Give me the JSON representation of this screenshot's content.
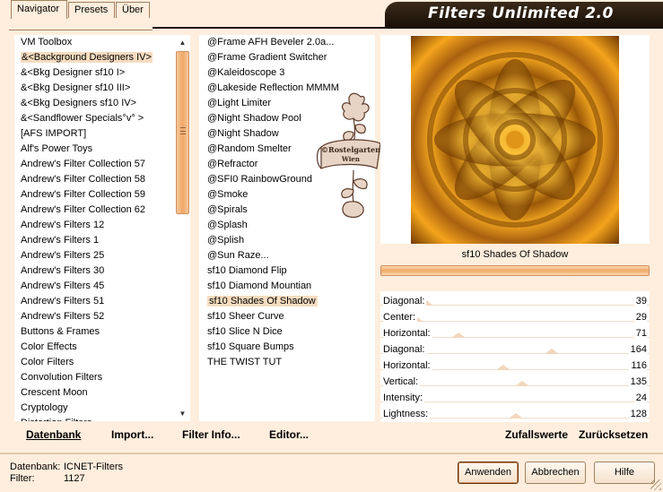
{
  "app": {
    "title": "Filters Unlimited 2.0"
  },
  "tabs": [
    {
      "label": "Navigator",
      "active": true
    },
    {
      "label": "Presets",
      "active": false
    },
    {
      "label": "Über",
      "active": false
    }
  ],
  "categories": {
    "selected_index": 1,
    "items": [
      "VM Toolbox",
      "&<Background Designers IV>",
      "&<Bkg Designer sf10 I>",
      "&<Bkg Designer sf10 III>",
      "&<Bkg Designers sf10 IV>",
      "&<Sandflower Specials°v° >",
      "[AFS IMPORT]",
      "Alf's Power Toys",
      "Andrew's Filter Collection 57",
      "Andrew's Filter Collection 58",
      "Andrew's Filter Collection 59",
      "Andrew's Filter Collection 62",
      "Andrew's Filters 12",
      "Andrew's Filters 1",
      "Andrew's Filters 25",
      "Andrew's Filters 30",
      "Andrew's Filters 45",
      "Andrew's Filters 51",
      "Andrew's Filters 52",
      "Buttons & Frames",
      "Color Effects",
      "Color Filters",
      "Convolution Filters",
      "Crescent Moon",
      "Cryptology",
      "Distortion Filters"
    ]
  },
  "filters": {
    "selected_index": 17,
    "items": [
      "@Frame AFH Beveler 2.0a...",
      "@Frame Gradient Switcher",
      "@Kaleidoscope 3",
      "@Lakeside Reflection MMMM",
      "@Light Limiter",
      "@Night Shadow Pool",
      "@Night Shadow",
      "@Random Smelter",
      "@Refractor",
      "@SFI0 RainbowGround",
      "@Smoke",
      "@Spirals",
      "@Splash",
      "@Splish",
      "@Sun Raze...",
      "sf10 Diamond Flip",
      "sf10 Diamond Mountian",
      "sf10 Shades Of Shadow",
      "sf10 Sheer Curve",
      "sf10 Slice N Dice",
      "sf10 Square Bumps",
      "THE TWIST TUT"
    ]
  },
  "watermark": {
    "line1": "©Rostelgarten",
    "line2": "Wien"
  },
  "preview": {
    "filter_name": "sf10 Shades Of Shadow"
  },
  "params": [
    {
      "label": "Diagonal:",
      "value": "39",
      "level": 39
    },
    {
      "label": "Center:",
      "value": "29",
      "level": 29
    },
    {
      "label": "Horizontal:",
      "value": "71",
      "level": 71
    },
    {
      "label": "Diagonal:",
      "value": "164",
      "level": 164
    },
    {
      "label": "Horizontal:",
      "value": "116",
      "level": 116
    },
    {
      "label": "Vertical:",
      "value": "135",
      "level": 135
    },
    {
      "label": "Intensity:",
      "value": "24",
      "level": 24
    },
    {
      "label": "Lightness:",
      "value": "128",
      "level": 128
    }
  ],
  "actions": {
    "datenbank": "Datenbank",
    "import": "Import...",
    "filter_info": "Filter Info...",
    "editor": "Editor...",
    "zufallswerte": "Zufallswerte",
    "zuruecksetzen": "Zurücksetzen"
  },
  "status": {
    "db_label": "Datenbank:",
    "db_value": "ICNET-Filters",
    "filter_label": "Filter:",
    "filter_value": "1127"
  },
  "buttons": {
    "apply": "Anwenden",
    "cancel": "Abbrechen",
    "help": "Hilfe"
  },
  "colors": {
    "background": "#ffeedd",
    "accent": "#f0a868",
    "selection": "#f5dcc0",
    "title_bar": "#1a1008"
  }
}
